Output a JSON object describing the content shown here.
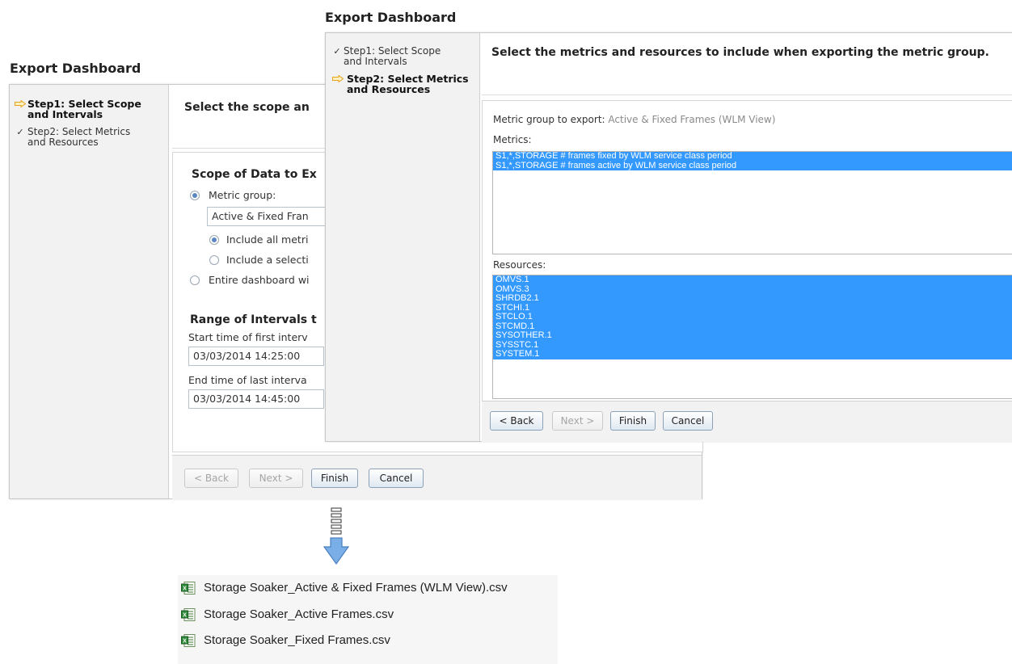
{
  "back_dialog": {
    "title": "Export Dashboard",
    "steps": [
      {
        "label_line1": "Step1: Select Scope",
        "label_line2": "and Intervals",
        "state": "current"
      },
      {
        "label_line1": "Step2: Select Metrics",
        "label_line2": "and Resources",
        "state": "done"
      }
    ],
    "header": "Select the scope an",
    "scope_heading": "Scope of Data to Ex",
    "metric_group_label": "Metric group:",
    "metric_group_value": "Active & Fixed Fran",
    "include_all": "Include all metri",
    "include_selection": "Include a selecti",
    "entire_dashboard": "Entire dashboard wi",
    "range_heading": "Range of Intervals t",
    "start_label": "Start time of first interv",
    "start_value": "03/03/2014 14:25:00",
    "end_label": "End time of last interva",
    "end_value": "03/03/2014 14:45:00",
    "buttons": {
      "back": "< Back",
      "next": "Next >",
      "finish": "Finish",
      "cancel": "Cancel"
    }
  },
  "front_dialog": {
    "title": "Export Dashboard",
    "steps": [
      {
        "label_line1": "Step1: Select Scope",
        "label_line2": "and Intervals",
        "state": "done"
      },
      {
        "label_line1": "Step2: Select Metrics",
        "label_line2": "and Resources",
        "state": "current"
      }
    ],
    "header": "Select the metrics and resources to include when exporting the metric group.",
    "metric_group_prefix": "Metric group to export:",
    "metric_group_name": "Active & Fixed Frames (WLM View)",
    "metrics_label": "Metrics:",
    "metrics": [
      "S1,*,STORAGE # frames fixed by WLM service class period",
      "S1,*,STORAGE # frames active by WLM service class period"
    ],
    "resources_label": "Resources:",
    "resources": [
      "OMVS.1",
      "OMVS.3",
      "SHRDB2.1",
      "STCHI.1",
      "STCLO.1",
      "STCMD.1",
      "SYSOTHER.1",
      "SYSSTC.1",
      "SYSTEM.1"
    ],
    "buttons": {
      "back": "< Back",
      "next": "Next >",
      "finish": "Finish",
      "cancel": "Cancel"
    }
  },
  "files": [
    "Storage Soaker_Active & Fixed Frames (WLM View).csv",
    "Storage Soaker_Active Frames.csv",
    "Storage Soaker_Fixed Frames.csv"
  ],
  "colors": {
    "selection": "#3399ff",
    "arrow": "#6fa0d8",
    "step_arrow": "#f0a020"
  },
  "icons": {
    "step_current": "right-arrow-icon",
    "step_done": "checkmark-icon",
    "file": "excel-csv-icon",
    "flow": "down-arrow-icon"
  }
}
